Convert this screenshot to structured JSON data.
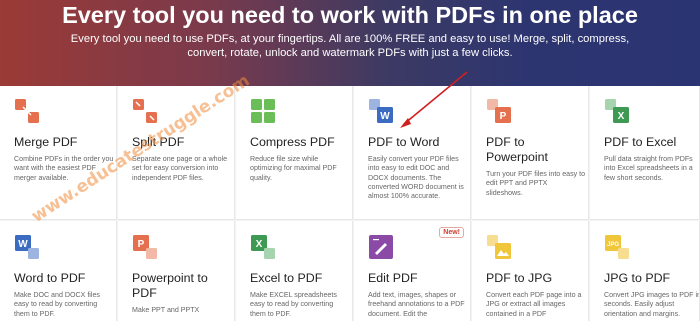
{
  "hero": {
    "title": "Every tool you need to work with PDFs in one place",
    "subtitle": "Every tool you need to use PDFs, at your fingertips. All are 100% FREE and easy to use! Merge, split, compress, convert, rotate, unlock and watermark PDFs with just a few clicks."
  },
  "tools": [
    {
      "title": "Merge PDF",
      "desc": "Combine PDFs in the order you want with the easiest PDF merger available.",
      "icon": "merge-icon",
      "color": "#e5704f"
    },
    {
      "title": "Split PDF",
      "desc": "Separate one page or a whole set for easy conversion into independent PDF files.",
      "icon": "split-icon",
      "color": "#e5704f"
    },
    {
      "title": "Compress PDF",
      "desc": "Reduce file size while optimizing for maximal PDF quality.",
      "icon": "compress-icon",
      "color": "#6bbd57"
    },
    {
      "title": "PDF to Word",
      "desc": "Easily convert your PDF files into easy to edit DOC and DOCX documents. The converted WORD document is almost 100% accurate.",
      "icon": "pdf-to-word-icon",
      "color": "#3b6cc2"
    },
    {
      "title": "PDF to Powerpoint",
      "desc": "Turn your PDF files into easy to edit PPT and PPTX slideshows.",
      "icon": "pdf-to-powerpoint-icon",
      "color": "#e5704f"
    },
    {
      "title": "PDF to Excel",
      "desc": "Pull data straight from PDFs into Excel spreadsheets in a few short seconds.",
      "icon": "pdf-to-excel-icon",
      "color": "#3e9a52"
    },
    {
      "title": "Word to PDF",
      "desc": "Make DOC and DOCX files easy to read by converting them to PDF.",
      "icon": "word-to-pdf-icon",
      "color": "#3b6cc2"
    },
    {
      "title": "Powerpoint to PDF",
      "desc": "Make PPT and PPTX",
      "icon": "powerpoint-to-pdf-icon",
      "color": "#e5704f"
    },
    {
      "title": "Excel to PDF",
      "desc": "Make EXCEL spreadsheets easy to read by converting them to PDF.",
      "icon": "excel-to-pdf-icon",
      "color": "#3e9a52"
    },
    {
      "title": "Edit PDF",
      "desc": "Add text, images, shapes or freehand annotations to a PDF document. Edit the",
      "icon": "edit-pdf-icon",
      "color": "#8b4aa6",
      "badge": "New!"
    },
    {
      "title": "PDF to JPG",
      "desc": "Convert each PDF page into a JPG or extract all images contained in a PDF",
      "icon": "pdf-to-jpg-icon",
      "color": "#f0c63a"
    },
    {
      "title": "JPG to PDF",
      "desc": "Convert JPG images to PDF in seconds. Easily adjust orientation and margins.",
      "icon": "jpg-to-pdf-icon",
      "color": "#f0c63a"
    }
  ],
  "watermark": "www.educatestruggle.com"
}
